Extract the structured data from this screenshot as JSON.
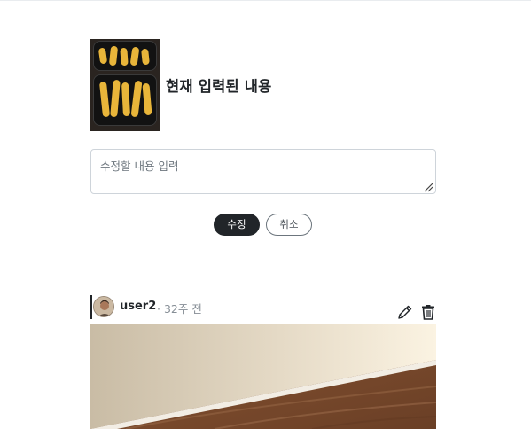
{
  "current_post": {
    "thumbnail_icon": "food-photo-thumbnail",
    "content": "현재 입력된 내용"
  },
  "edit_form": {
    "placeholder": "수정할 내용 입력",
    "value": "",
    "submit_label": "수정",
    "cancel_label": "취소"
  },
  "post": {
    "author": "user2",
    "time": "· 32주 전",
    "edit_icon": "pencil-icon",
    "delete_icon": "trash-icon",
    "image_icon": "paper-on-wood-photo"
  },
  "colors": {
    "primary": "#212529",
    "muted": "#868e96",
    "border": "#ced4da"
  }
}
